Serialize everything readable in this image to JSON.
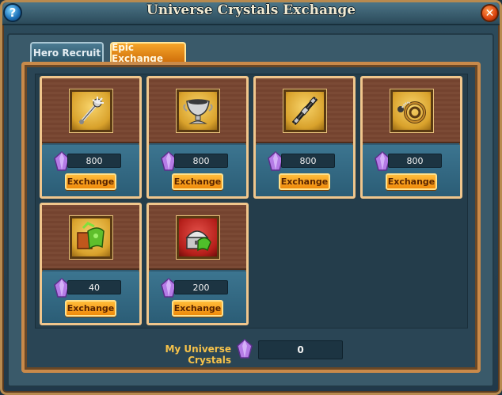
{
  "window": {
    "title": "Universe Crystals Exchange",
    "help_glyph": "?",
    "close_glyph": "✕"
  },
  "tabs": [
    {
      "label": "Hero Recruit",
      "active": false
    },
    {
      "label": "Epic Exchange",
      "active": true
    }
  ],
  "items": [
    {
      "icon": "spiked-mace-icon",
      "price": "800",
      "button": "Exchange",
      "frame": "gold"
    },
    {
      "icon": "silver-chalice-icon",
      "price": "800",
      "button": "Exchange",
      "frame": "gold"
    },
    {
      "icon": "dark-staff-icon",
      "price": "800",
      "button": "Exchange",
      "frame": "gold"
    },
    {
      "icon": "chain-whip-icon",
      "price": "800",
      "button": "Exchange",
      "frame": "gold"
    },
    {
      "icon": "green-book-icon",
      "price": "40",
      "button": "Exchange",
      "frame": "gold"
    },
    {
      "icon": "treasure-chest-icon",
      "price": "200",
      "button": "Exchange",
      "frame": "red"
    }
  ],
  "footer": {
    "label": "My Universe Crystals",
    "value": "0"
  },
  "colors": {
    "accent_orange": "#f08a0a",
    "frame_tan": "#f0c68c",
    "crystal_purple": "#b57be6"
  }
}
